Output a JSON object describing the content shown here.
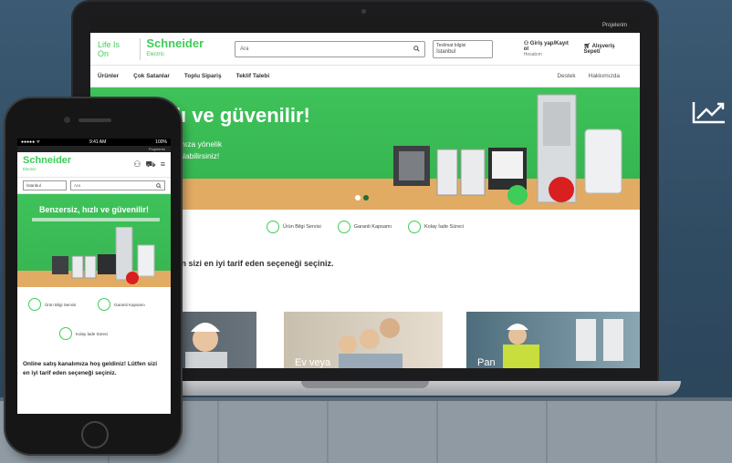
{
  "laptop": {
    "topbar_link": "Projelerim",
    "lifeison": "Life Is On",
    "brand": "Schneider",
    "brand_sub": "Electric",
    "search_placeholder": "Ara",
    "location_small": "Teslimat bilgisi",
    "location_city": "İstanbul",
    "login_label": "Giriş yap/Kayıt ol",
    "login_sub": "Hesabım",
    "cart_label": "Alışveriş Sepeti",
    "nav": [
      "Ürünler",
      "Çok Satanlar",
      "Toplu Sipariş",
      "Teklif Talebi"
    ],
    "nav_right": [
      "Destek",
      "Hakkımızda"
    ],
    "hero_title": "ersiz, hızlı ve güvenilir!",
    "hero_sub_1": "ectric uzmanlığıyla ihtiyacınıza yönelik",
    "hero_sub_2": "zümlerimizi tek tıkla satın alabilirsiniz!",
    "services": [
      "Ürün Bilgi Servisi",
      "Garanti Kapsamı",
      "Kolay İade Süreci"
    ],
    "welcome": "nıza hoş geldiniz! Lütfen sizi en iyi tarif eden seçeneği seçiniz.",
    "cards": [
      "Ev veya",
      "Pan"
    ]
  },
  "phone": {
    "status_time": "9:41 AM",
    "status_battery": "100%",
    "status_carrier": "●●●●● ᯤ",
    "topbar_link": "Projelerim",
    "brand": "Schneider",
    "brand_sub": "Electric",
    "location": "İstanbul",
    "search_placeholder": "Ara",
    "hero_title": "Benzersiz, hızlı ve güvenilir!",
    "services": [
      "Ürün Bilgi Servisi",
      "Garanti Kapsamı",
      "Kolay İade Süreci"
    ],
    "welcome": "Online satış kanalımıza hoş geldiniz! Lütfen sizi en iyi tarif eden seçeneği seçiniz."
  },
  "colors": {
    "brand_green": "#3dcd58",
    "hero_green": "#3fc25a",
    "wood": "#e2ab64"
  },
  "icons": [
    "trend-up-icon",
    "search-icon",
    "user-icon",
    "cart-icon",
    "menu-icon",
    "chevron-down-icon"
  ]
}
